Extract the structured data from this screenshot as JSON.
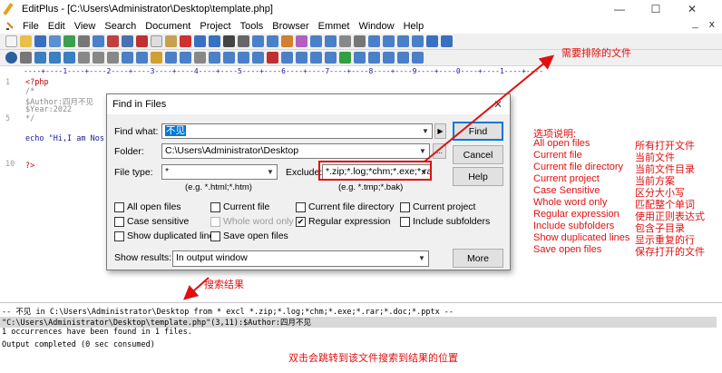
{
  "window": {
    "title": "EditPlus - [C:\\Users\\Administrator\\Desktop\\template.php]",
    "minimize": "—",
    "maximize": "☐",
    "close": "✕"
  },
  "menu": [
    "File",
    "Edit",
    "View",
    "Search",
    "Document",
    "Project",
    "Tools",
    "Browser",
    "Emmet",
    "Window",
    "Help"
  ],
  "menu_right": [
    "_",
    "ⅹ"
  ],
  "ruler": "----+----1----+----2----+----3----+----4----+----5----+----6----+----7----+----8----+----9----+----0----+----1----+----",
  "editor": {
    "line_numbers": [
      "1",
      "",
      "",
      "",
      "5",
      "",
      "",
      "",
      "",
      "10"
    ],
    "code": [
      "<?php",
      "/*",
      "$Author:四月不见",
      "$Year:2022",
      "*/",
      "",
      "echo \"Hi,I am Nos",
      "",
      "",
      "?>"
    ]
  },
  "dialog": {
    "title": "Find in Files",
    "close": "✕",
    "find_what_label": "Find what:",
    "find_what_value": "不见",
    "folder_label": "Folder:",
    "folder_value": "C:\\Users\\Administrator\\Desktop",
    "folder_button": "...",
    "file_type_label": "File type:",
    "file_type_value": "*",
    "file_type_hint": "(e.g. *.html;*.htm)",
    "exclude_label": "Exclude:",
    "exclude_value": "*.zip;*.log;*chm;*.exe;*.ra",
    "exclude_hint": "(e.g. *.tmp;*.bak)",
    "options": [
      {
        "label": "All open files",
        "checked": false,
        "enabled": true
      },
      {
        "label": "Current file",
        "checked": false,
        "enabled": true
      },
      {
        "label": "Current file directory",
        "checked": false,
        "enabled": true
      },
      {
        "label": "Current project",
        "checked": false,
        "enabled": true
      },
      {
        "label": "Case sensitive",
        "checked": false,
        "enabled": true
      },
      {
        "label": "Whole word only",
        "checked": false,
        "enabled": false
      },
      {
        "label": "Regular expression",
        "checked": true,
        "enabled": true
      },
      {
        "label": "Include subfolders",
        "checked": false,
        "enabled": true
      },
      {
        "label": "Show duplicated lines",
        "checked": false,
        "enabled": true
      },
      {
        "label": "Save open files",
        "checked": false,
        "enabled": true
      }
    ],
    "show_results_label": "Show results:",
    "show_results_value": "In output window",
    "buttons": {
      "find": "Find",
      "cancel": "Cancel",
      "help": "Help",
      "more": "More"
    }
  },
  "annotations": {
    "exclude_note": "需要排除的文件",
    "options_title": "选项说明:",
    "options": [
      {
        "en": "All open files",
        "zh": "所有打开文件"
      },
      {
        "en": "Current file",
        "zh": "当前文件"
      },
      {
        "en": "Current file directory",
        "zh": "当前文件目录"
      },
      {
        "en": "Current project",
        "zh": "当前方案"
      },
      {
        "en": "Case Sensitive",
        "zh": "区分大小写"
      },
      {
        "en": "Whole word only",
        "zh": "匹配整个单词"
      },
      {
        "en": "Regular expression",
        "zh": "使用正则表达式"
      },
      {
        "en": "Include subfolders",
        "zh": "包含子目录"
      },
      {
        "en": "Show duplicated lines",
        "zh": "显示重复的行"
      },
      {
        "en": "Save open files",
        "zh": "保存打开的文件"
      }
    ],
    "results_note": "搜索结果",
    "doubleclick_note": "双击会跳转到该文件搜索到结果的位置"
  },
  "output": {
    "lines": [
      "-- 不见 in C:\\Users\\Administrator\\Desktop from * excl *.zip;*.log;*chm;*.exe;*.rar;*.doc;*.pptx --",
      "\"C:\\Users\\Administrator\\Desktop\\template.php\"(3,11):$Author:四月不见",
      "1 occurrences have been found in 1 files.",
      "Output completed (0 sec consumed)"
    ]
  },
  "colors": {
    "annotation": "#e01010",
    "selection": "#0078d7",
    "dialog_bg": "#f0f0f0",
    "code_red": "#c00000",
    "code_green": "#008000"
  }
}
